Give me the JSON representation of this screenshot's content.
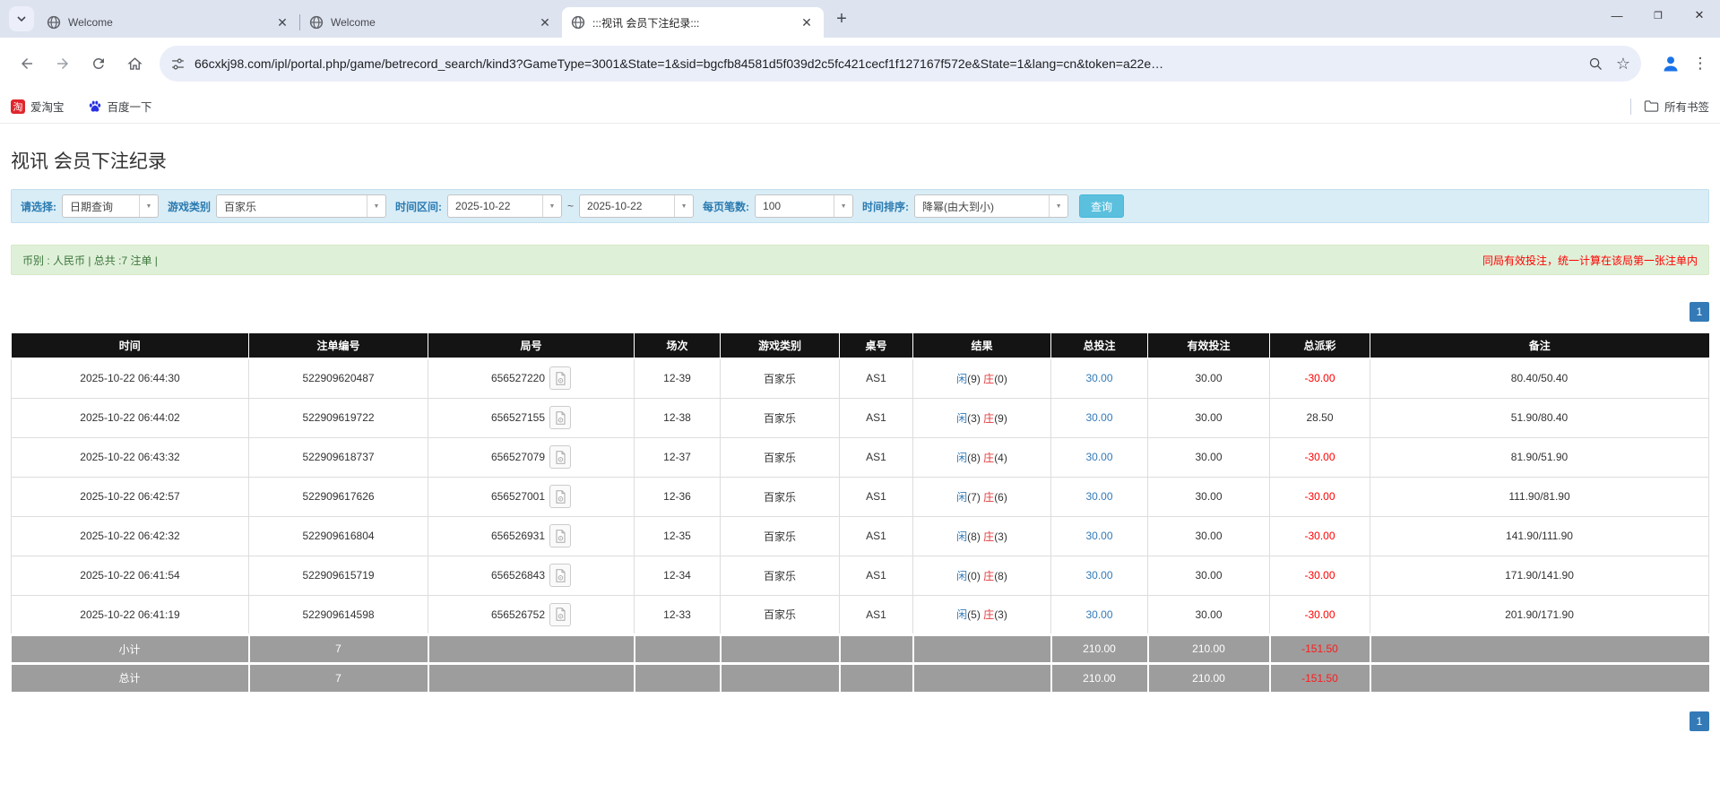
{
  "browser": {
    "tabs": [
      {
        "label": "Welcome",
        "active": false
      },
      {
        "label": "Welcome",
        "active": false
      },
      {
        "label": ":::视讯 会员下注纪录:::",
        "active": true
      }
    ],
    "url": "66cxkj98.com/ipl/portal.php/game/betrecord_search/kind3?GameType=3001&State=1&sid=bgcfb84581d5f039d2c5fc421cecf1f127167f572e&State=1&lang=cn&token=a22e…",
    "bookmarks": [
      {
        "label": "爱淘宝",
        "icon": "taobao-icon",
        "icon_glyph": "淘"
      },
      {
        "label": "百度一下",
        "icon": "baidu-icon"
      }
    ],
    "all_bookmarks_label": "所有书签"
  },
  "page": {
    "title": "视讯 会员下注纪录",
    "filters": {
      "select_label": "请选择:",
      "select_value": "日期查询",
      "game_type_label": "游戏类别",
      "game_type_value": "百家乐",
      "date_range_label": "时间区间:",
      "date_from": "2025-10-22",
      "tilde": "~",
      "date_to": "2025-10-22",
      "per_page_label": "每页笔数:",
      "per_page_value": "100",
      "sort_label": "时间排序:",
      "sort_value": "降幂(由大到小)",
      "query_button": "查询"
    },
    "summary": {
      "left": "币别 : 人民币 | 总共 :7 注单 |",
      "right": "同局有效投注，统一计算在该局第一张注单内"
    },
    "pagination": {
      "page": "1"
    },
    "table": {
      "headers": [
        "时间",
        "注单编号",
        "局号",
        "场次",
        "游戏类别",
        "桌号",
        "结果",
        "总投注",
        "有效投注",
        "总派彩",
        "备注"
      ],
      "rows": [
        {
          "time": "2025-10-22 06:44:30",
          "bet_no": "522909620487",
          "round_no": "656527220",
          "session": "12-39",
          "game_type": "百家乐",
          "table_no": "AS1",
          "result": {
            "player": "闲",
            "player_score": "(9)",
            "banker": "庄",
            "banker_score": "(0)"
          },
          "total_bet": "30.00",
          "valid_bet": "30.00",
          "payout": "-30.00",
          "remark": "80.40/50.40"
        },
        {
          "time": "2025-10-22 06:44:02",
          "bet_no": "522909619722",
          "round_no": "656527155",
          "session": "12-38",
          "game_type": "百家乐",
          "table_no": "AS1",
          "result": {
            "player": "闲",
            "player_score": "(3)",
            "banker": "庄",
            "banker_score": "(9)"
          },
          "total_bet": "30.00",
          "valid_bet": "30.00",
          "payout": "28.50",
          "remark": "51.90/80.40"
        },
        {
          "time": "2025-10-22 06:43:32",
          "bet_no": "522909618737",
          "round_no": "656527079",
          "session": "12-37",
          "game_type": "百家乐",
          "table_no": "AS1",
          "result": {
            "player": "闲",
            "player_score": "(8)",
            "banker": "庄",
            "banker_score": "(4)"
          },
          "total_bet": "30.00",
          "valid_bet": "30.00",
          "payout": "-30.00",
          "remark": "81.90/51.90"
        },
        {
          "time": "2025-10-22 06:42:57",
          "bet_no": "522909617626",
          "round_no": "656527001",
          "session": "12-36",
          "game_type": "百家乐",
          "table_no": "AS1",
          "result": {
            "player": "闲",
            "player_score": "(7)",
            "banker": "庄",
            "banker_score": "(6)"
          },
          "total_bet": "30.00",
          "valid_bet": "30.00",
          "payout": "-30.00",
          "remark": "111.90/81.90"
        },
        {
          "time": "2025-10-22 06:42:32",
          "bet_no": "522909616804",
          "round_no": "656526931",
          "session": "12-35",
          "game_type": "百家乐",
          "table_no": "AS1",
          "result": {
            "player": "闲",
            "player_score": "(8)",
            "banker": "庄",
            "banker_score": "(3)"
          },
          "total_bet": "30.00",
          "valid_bet": "30.00",
          "payout": "-30.00",
          "remark": "141.90/111.90"
        },
        {
          "time": "2025-10-22 06:41:54",
          "bet_no": "522909615719",
          "round_no": "656526843",
          "session": "12-34",
          "game_type": "百家乐",
          "table_no": "AS1",
          "result": {
            "player": "闲",
            "player_score": "(0)",
            "banker": "庄",
            "banker_score": "(8)"
          },
          "total_bet": "30.00",
          "valid_bet": "30.00",
          "payout": "-30.00",
          "remark": "171.90/141.90"
        },
        {
          "time": "2025-10-22 06:41:19",
          "bet_no": "522909614598",
          "round_no": "656526752",
          "session": "12-33",
          "game_type": "百家乐",
          "table_no": "AS1",
          "result": {
            "player": "闲",
            "player_score": "(5)",
            "banker": "庄",
            "banker_score": "(3)"
          },
          "total_bet": "30.00",
          "valid_bet": "30.00",
          "payout": "-30.00",
          "remark": "201.90/171.90"
        }
      ],
      "footer": [
        {
          "label": "小计",
          "count": "7",
          "total_bet": "210.00",
          "valid_bet": "210.00",
          "payout": "-151.50"
        },
        {
          "label": "总计",
          "count": "7",
          "total_bet": "210.00",
          "valid_bet": "210.00",
          "payout": "-151.50"
        }
      ]
    }
  },
  "colors": {
    "accent_blue": "#337ab7",
    "negative_red": "#ff0000",
    "result_player_blue": "#337ab7",
    "result_banker_red": "#e4393c",
    "filter_bg": "#d9edf7",
    "summary_bg": "#dff0d8",
    "query_button_bg": "#5bc0de",
    "table_header_bg": "#141414",
    "table_footer_bg": "#9d9d9d"
  }
}
